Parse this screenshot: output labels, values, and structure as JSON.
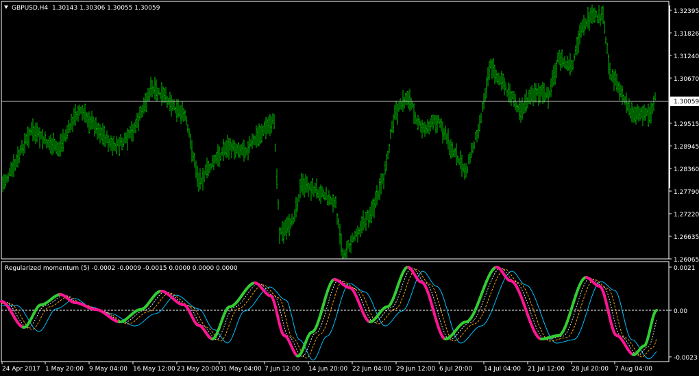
{
  "window": {
    "symbol_label": "GBPUSD,H4",
    "ohlc_label": "1.30143 1.30306 1.30055 1.30059",
    "current_price": "1.30059"
  },
  "colors": {
    "background": "#000000",
    "price_bars": "#00c000",
    "frame": "#ffffff",
    "momentum_up": "#33cc33",
    "momentum_down": "#ff1493",
    "signal_1": "#ffa500",
    "signal_2": "#00bfff",
    "zero_line": "#ffffff"
  },
  "price_axis": {
    "ticks": [
      "1.32395",
      "1.31826",
      "1.31240",
      "1.30670",
      "1.29515",
      "1.28945",
      "1.28360",
      "1.27790",
      "1.27220",
      "1.26635",
      "1.26065"
    ],
    "range": [
      1.26,
      1.325
    ]
  },
  "indicator": {
    "label": "Regularized momentum (5) -0.0002 -0.0009 -0.0015 0.0000 0.0000 0.0000",
    "ticks": [
      "0.0021",
      "0.00",
      "-0.0023"
    ],
    "range": [
      -0.0023,
      0.0021
    ]
  },
  "time_axis": {
    "labels": [
      "24 Apr 2017",
      "1 May 20:00",
      "9 May 04:00",
      "16 May 12:00",
      "23 May 20:00",
      "31 May 04:00",
      "7 Jun 12:00",
      "14 Jun 20:00",
      "22 Jun 04:00",
      "29 Jun 12:00",
      "6 Jul 20:00",
      "14 Jul 04:00",
      "21 Jul 12:00",
      "28 Jul 20:00",
      "7 Aug 04:00"
    ]
  }
}
